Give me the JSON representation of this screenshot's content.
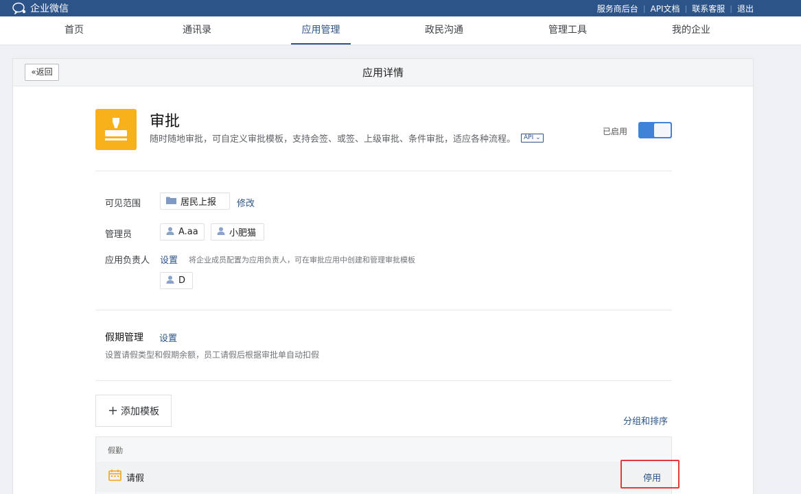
{
  "top_bar": {
    "logo_text": "企业微信",
    "links": [
      "服务商后台",
      "API文档",
      "联系客服",
      "退出"
    ]
  },
  "nav": {
    "items": [
      "首页",
      "通讯录",
      "应用管理",
      "政民沟通",
      "管理工具",
      "我的企业"
    ],
    "active": "应用管理"
  },
  "panel": {
    "back_label": "返回",
    "title": "应用详情"
  },
  "app": {
    "name": "审批",
    "description": "随时随地审批，可自定义审批模板，支持会签、或签、上级审批、条件审批，适应各种流程。",
    "api_tag": "API",
    "status_label": "已启用",
    "enabled": true,
    "icon": "stamp-icon",
    "icon_color": "#f7b21b"
  },
  "visibility": {
    "label": "可见范围",
    "value": "居民上报",
    "edit_label": "修改"
  },
  "admins": {
    "label": "管理员",
    "items": [
      "A.aa",
      "小肥猫"
    ]
  },
  "owner": {
    "label": "应用负责人",
    "set_label": "设置",
    "hint": "将企业成员配置为应用负责人，可在审批应用中创建和管理审批模板",
    "items": [
      "D"
    ]
  },
  "leave_mgmt": {
    "title": "假期管理",
    "set_label": "设置",
    "hint": "设置请假类型和假期余额，员工请假后根据审批单自动扣假"
  },
  "templates": {
    "add_label": "添加模板",
    "group_sort_label": "分组和排序",
    "groups": [
      {
        "name": "假勤",
        "items": [
          {
            "name": "请假",
            "action": "停用",
            "icon": "calendar-icon"
          }
        ]
      }
    ]
  },
  "colors": {
    "brand": "#2c5488",
    "toggle_on": "#3f82d8",
    "highlight": "#e23a3a"
  }
}
